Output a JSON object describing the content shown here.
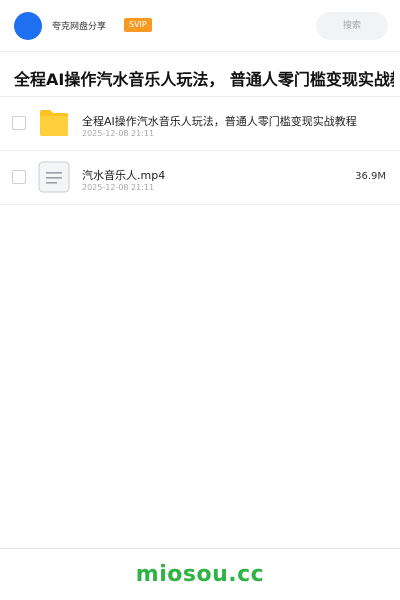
{
  "header": {
    "brand": "夸克网盘分享",
    "badge": "SVIP",
    "search_placeholder": "搜索"
  },
  "share": {
    "title": "全程AI操作汽水音乐人玩法， 普通人零门槛变现实战教程"
  },
  "files": [
    {
      "name": "全程AI操作汽水音乐人玩法，普通人零门槛变现实战教程",
      "date": "2025-12-08 21:11",
      "size": "",
      "type": "folder",
      "icon": "folder-icon"
    },
    {
      "name": "汽水音乐人.mp4",
      "date": "2025-12-08 21:11",
      "size": "36.9M",
      "type": "file",
      "icon": "document-icon"
    }
  ],
  "footer": {
    "logo": "miosou.cc"
  },
  "colors": {
    "avatar": "#1f6ff1",
    "badge": "#f59a23",
    "folder": "#ffc31f",
    "footer_logo": "#2fb344"
  }
}
